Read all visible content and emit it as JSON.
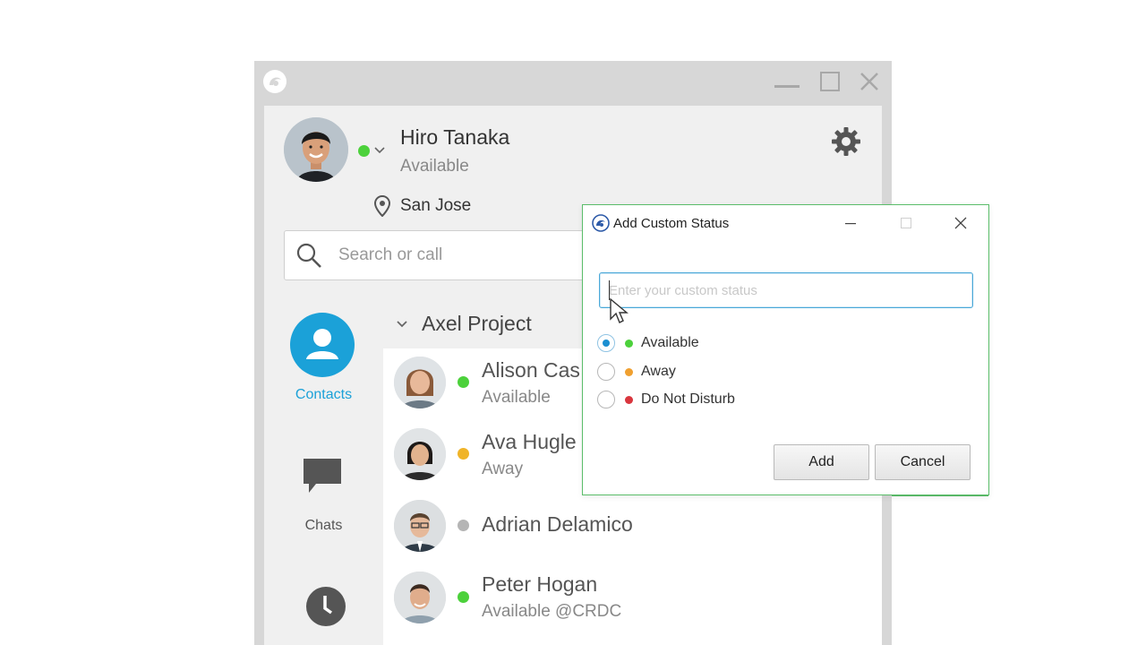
{
  "user": {
    "name": "Hiro Tanaka",
    "status": "Available",
    "location": "San Jose",
    "presence_color": "#4cd13b"
  },
  "search": {
    "placeholder": "Search or call"
  },
  "nav": {
    "contacts_label": "Contacts",
    "chats_label": "Chats",
    "accent": "#1ba1d8"
  },
  "group": {
    "name": "Axel Project"
  },
  "contacts": [
    {
      "name": "Alison Cas",
      "status": "Available",
      "presence": "available",
      "color": "#4cd13b"
    },
    {
      "name": "Ava Hugle",
      "status": "Away",
      "presence": "away",
      "color": "#f0b429"
    },
    {
      "name": "Adrian Delamico",
      "status": "",
      "presence": "offline",
      "color": "#b5b5b5"
    },
    {
      "name": "Peter Hogan",
      "status": "Available @CRDC",
      "presence": "available",
      "color": "#4cd13b"
    }
  ],
  "dialog": {
    "title": "Add Custom Status",
    "input_placeholder": "Enter your custom status",
    "input_value": "",
    "options": [
      {
        "label": "Available",
        "color": "#4cd13b",
        "selected": true
      },
      {
        "label": "Away",
        "color": "#f0a030",
        "selected": false
      },
      {
        "label": "Do Not Disturb",
        "color": "#d9363e",
        "selected": false
      }
    ],
    "add_label": "Add",
    "cancel_label": "Cancel",
    "border_color": "#5bbd6a"
  }
}
